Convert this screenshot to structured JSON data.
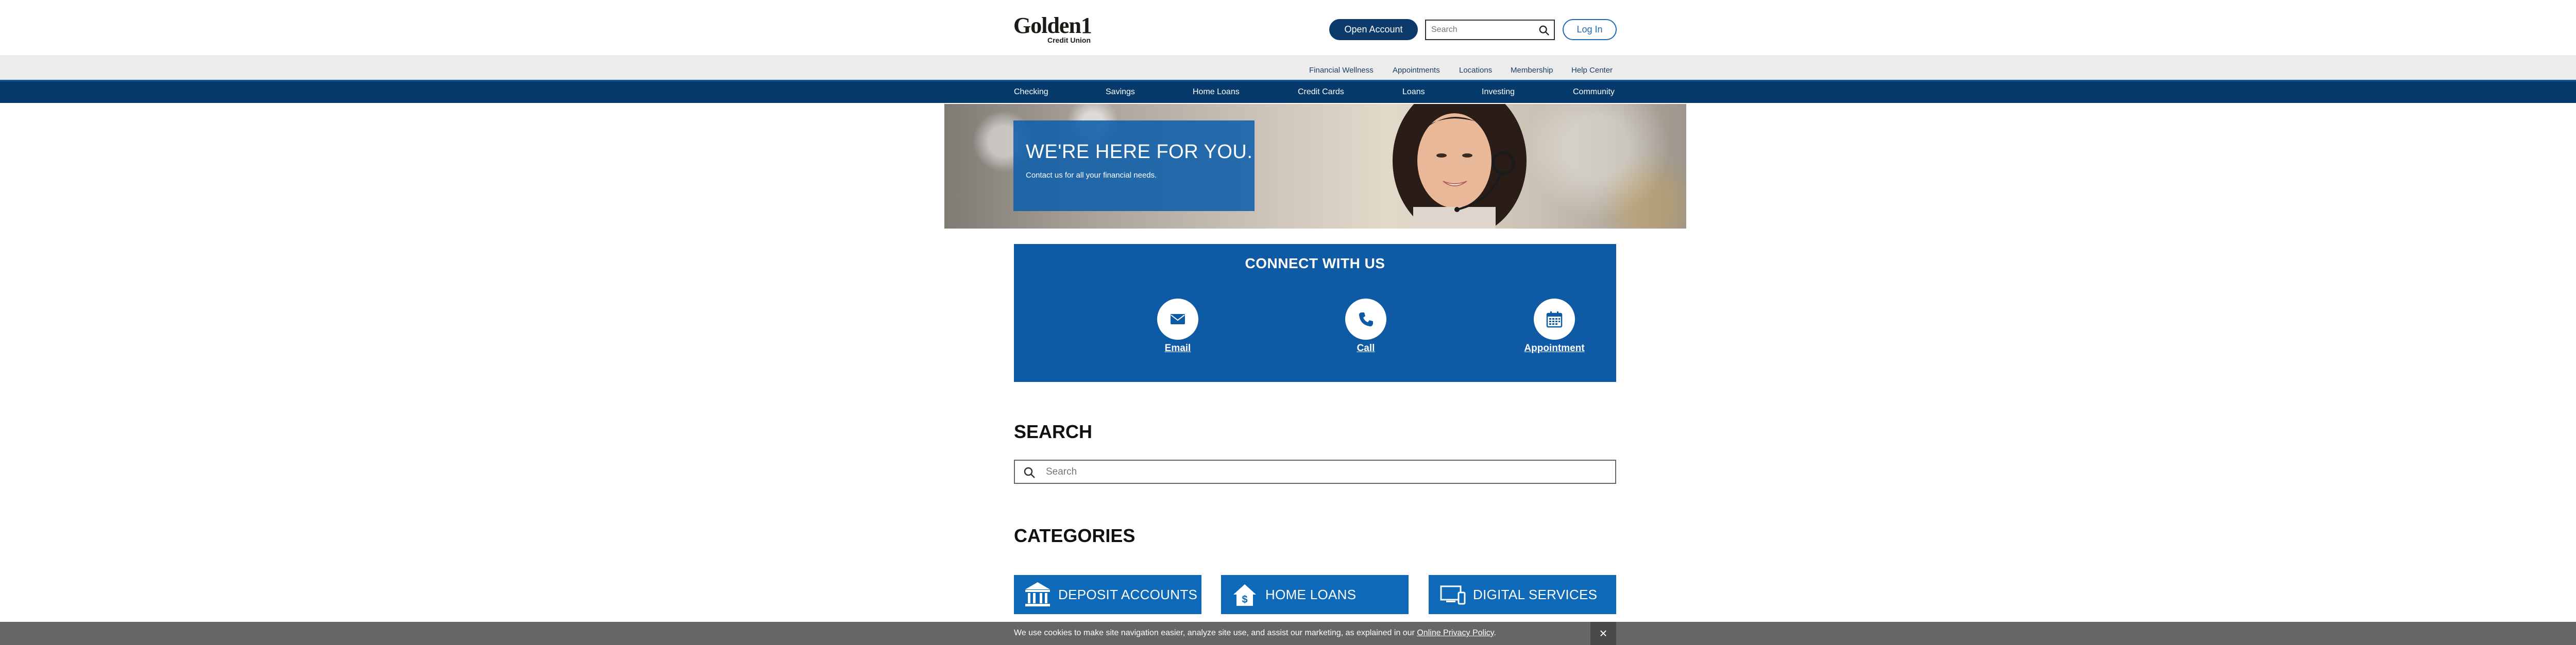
{
  "header": {
    "logo_main": "Golden1",
    "logo_sub": "Credit Union",
    "open_account_label": "Open Account",
    "search_placeholder": "Search",
    "login_label": "Log In"
  },
  "utility_nav": {
    "items": [
      "Financial Wellness",
      "Appointments",
      "Locations",
      "Membership",
      "Help Center"
    ]
  },
  "main_nav": {
    "items": [
      "Checking",
      "Savings",
      "Home Loans",
      "Credit Cards",
      "Loans",
      "Investing",
      "Community"
    ]
  },
  "hero": {
    "title": "WE'RE HERE FOR YOU.",
    "subtitle": "Contact us for all your financial needs."
  },
  "connect": {
    "title": "CONNECT WITH US",
    "items": [
      {
        "label": "Email",
        "icon": "envelope-icon"
      },
      {
        "label": "Call",
        "icon": "phone-icon"
      },
      {
        "label": "Appointment",
        "icon": "calendar-icon"
      }
    ]
  },
  "search_section": {
    "title": "SEARCH",
    "placeholder": "Search"
  },
  "categories": {
    "title": "CATEGORIES",
    "items": [
      {
        "label": "DEPOSIT ACCOUNTS",
        "icon": "bank-icon"
      },
      {
        "label": "HOME LOANS",
        "icon": "house-dollar-icon"
      },
      {
        "label": "DIGITAL SERVICES",
        "icon": "devices-icon"
      }
    ]
  },
  "cookie_bar": {
    "message": "We use cookies to make site navigation easier, analyze site use, and assist our marketing, as explained in our ",
    "link_label": "Online Privacy Policy",
    "suffix": ".",
    "close_label": "×"
  },
  "colors": {
    "brand_navy": "#063a6a",
    "brand_blue": "#0e5aa5",
    "button_blue": "#0e6ab8",
    "cookie_gray": "#666666"
  }
}
